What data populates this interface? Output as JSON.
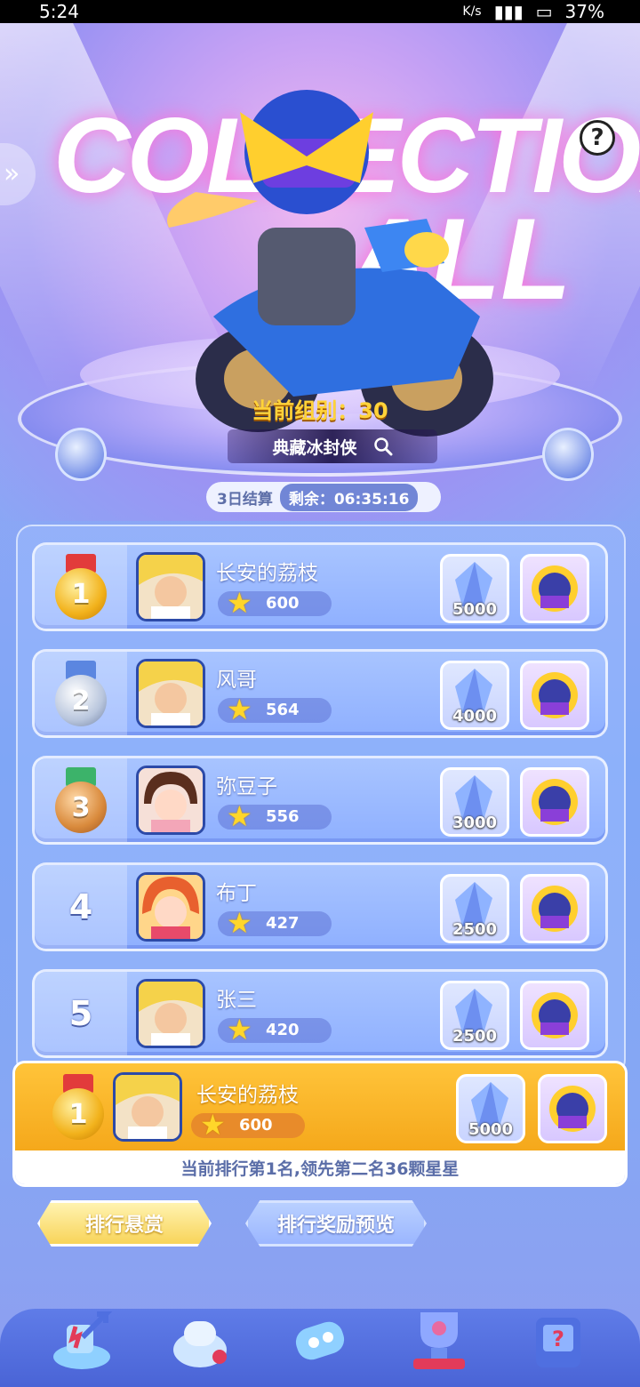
{
  "status_bar": {
    "time": "5:24",
    "net_speed": "K/s",
    "battery": "37%"
  },
  "hero": {
    "title_part1": "COLLECTION",
    "title_part2": "ALL",
    "group_label": "当前组别：30",
    "skin_name": "典藏冰封侠"
  },
  "timer": {
    "settle": "3日结算",
    "remaining": "剩余：06:35:16"
  },
  "leaderboard": [
    {
      "rank": "1",
      "name": "长安的荔枝",
      "stars": "600",
      "crystals": "5000"
    },
    {
      "rank": "2",
      "name": "风哥",
      "stars": "564",
      "crystals": "4000"
    },
    {
      "rank": "3",
      "name": "弥豆子",
      "stars": "556",
      "crystals": "3000"
    },
    {
      "rank": "4",
      "name": "布丁",
      "stars": "427",
      "crystals": "2500"
    },
    {
      "rank": "5",
      "name": "张三",
      "stars": "420",
      "crystals": "2500"
    }
  ],
  "my_rank": {
    "rank": "1",
    "name": "长安的荔枝",
    "stars": "600",
    "crystals": "5000",
    "summary": "当前排行第1名,领先第二名36颗星星"
  },
  "tabs": {
    "active": "排行悬赏",
    "inactive": "排行奖励预览"
  },
  "help_label": "?",
  "colors": {
    "gold": "#ffc43a",
    "board": "#8fb0ff",
    "nav": "#4a64d6"
  }
}
